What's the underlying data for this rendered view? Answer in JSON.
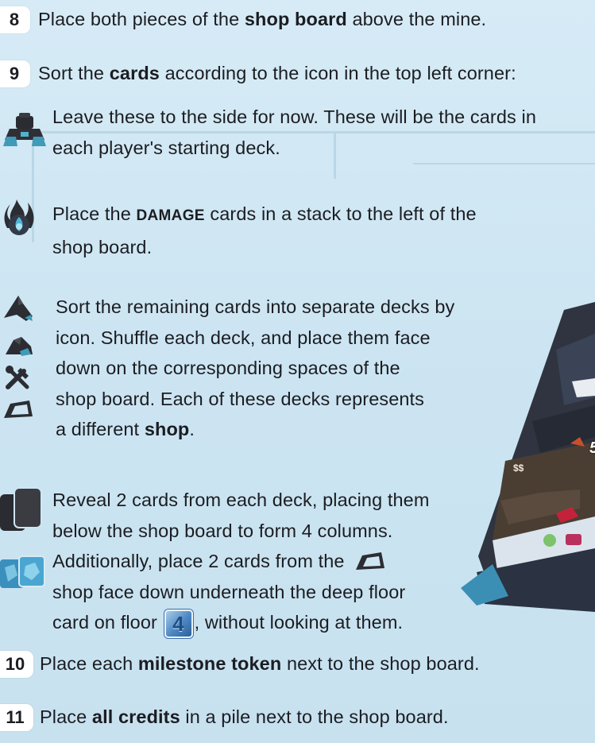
{
  "steps": [
    {
      "number": "8",
      "before": "Place both pieces of the ",
      "bold": "shop board",
      "after": " above the mine."
    },
    {
      "number": "9",
      "before": "Sort the ",
      "bold": "cards",
      "after": " according to the icon in the top left corner:"
    },
    {
      "number": "10",
      "before": "Place each ",
      "bold": "milestone token",
      "after": " next to the shop board."
    },
    {
      "number": "11",
      "before": "Place ",
      "bold": "all credits",
      "after": " in a pile next to the shop board."
    }
  ],
  "sub": {
    "starting": {
      "line1": "Leave these to the side for now. These will be the cards in",
      "line2": "each player's starting deck."
    },
    "damage": {
      "line1_pre": "Place the ",
      "line1_caps": "DAMAGE",
      "line1_post": " cards in a stack to the left of the",
      "line2": "shop board."
    },
    "sort": {
      "line1": "Sort the remaining cards into separate decks by",
      "line2": "icon. Shuffle each deck, and place them face",
      "line3": "down on the corresponding spaces of the",
      "line4": "shop board. Each of these decks represents",
      "line5_pre": "a different ",
      "line5_bold": "shop",
      "line5_post": "."
    },
    "reveal": {
      "line1": "Reveal 2 cards from each deck, placing them",
      "line2": "below the shop board to form 4 columns.",
      "line3": "Additionally, place 2 cards from the",
      "line4": "shop face down underneath the deep floor",
      "line5_pre": "card on floor",
      "floor_number": "4",
      "line5_post": ", without looking at them."
    }
  },
  "card_art": {
    "cost": "5",
    "price_symbol": "$$"
  },
  "icons": [
    "robot-icon",
    "fire-icon",
    "drill-icon",
    "rock-icon",
    "tools-icon",
    "mine-cart-icon",
    "card-backs-icon",
    "blue-card-icon"
  ],
  "colors": {
    "background": "#cfe6f2",
    "badge_bg": "#ffffff",
    "text": "#1b1d22",
    "floor_badge": "#3f7bbd"
  }
}
